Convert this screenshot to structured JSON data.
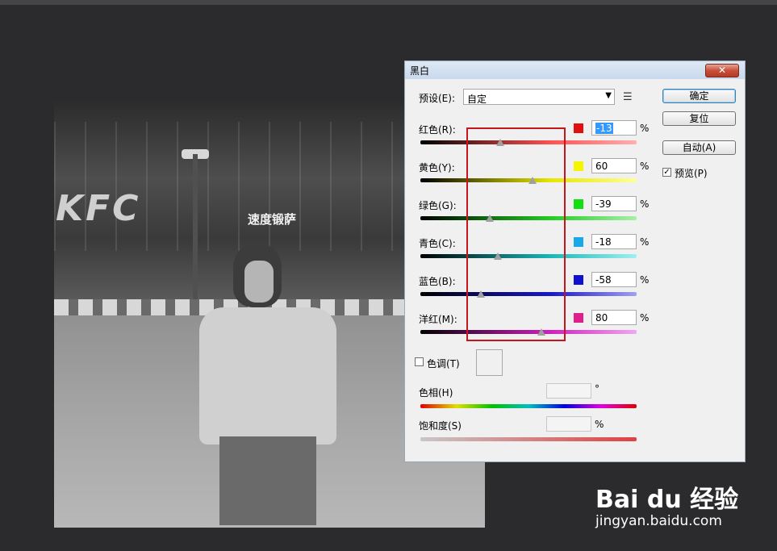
{
  "photo": {
    "sign_text": "KFC",
    "store_sign": "速度锻萨"
  },
  "dialog": {
    "title": "黑白",
    "close_glyph": "✕",
    "preset": {
      "label": "预设(E):",
      "value": "自定",
      "arrow": "▼",
      "menu_glyph": "☰"
    },
    "sliders": [
      {
        "label": "红色(R):",
        "value": "-13",
        "swatch": "#e01010",
        "gradient": "linear-gradient(90deg,#000 0%,#ff5050 60%,#ffb0b0 100%)",
        "position": 0.37,
        "selected": true
      },
      {
        "label": "黄色(Y):",
        "value": "60",
        "swatch": "#f5f500",
        "gradient": "linear-gradient(90deg,#000 0%,#e6e600 60%,#ffff99 100%)",
        "position": 0.52
      },
      {
        "label": "绿色(G):",
        "value": "-39",
        "swatch": "#10e010",
        "gradient": "linear-gradient(90deg,#000 0%,#22cc22 60%,#a8f0a8 100%)",
        "position": 0.32
      },
      {
        "label": "青色(C):",
        "value": "-18",
        "swatch": "#1aa8e8",
        "gradient": "linear-gradient(90deg,#000 0%,#18b8b8 60%,#a0f0f0 100%)",
        "position": 0.36
      },
      {
        "label": "蓝色(B):",
        "value": "-58",
        "swatch": "#1010d0",
        "gradient": "linear-gradient(90deg,#000 0%,#1818c8 60%,#a0a0f0 100%)",
        "position": 0.28
      },
      {
        "label": "洋红(M):",
        "value": "80",
        "swatch": "#e0208a",
        "gradient": "linear-gradient(90deg,#000 0%,#d020c0 60%,#f0a8f0 100%)",
        "position": 0.56
      }
    ],
    "percent_sign": "%",
    "tint": {
      "label": "色调(T)",
      "checked": false
    },
    "hue": {
      "label": "色相(H)",
      "unit": "°"
    },
    "saturation": {
      "label": "饱和度(S)",
      "unit": "%"
    },
    "buttons": {
      "ok": "确定",
      "reset": "复位",
      "auto": "自动(A)"
    },
    "preview": {
      "label": "预览(P)",
      "checked": true,
      "check_glyph": "✓"
    }
  },
  "watermark": {
    "main": "Bai du 经验",
    "sub": "jingyan.baidu.com"
  }
}
